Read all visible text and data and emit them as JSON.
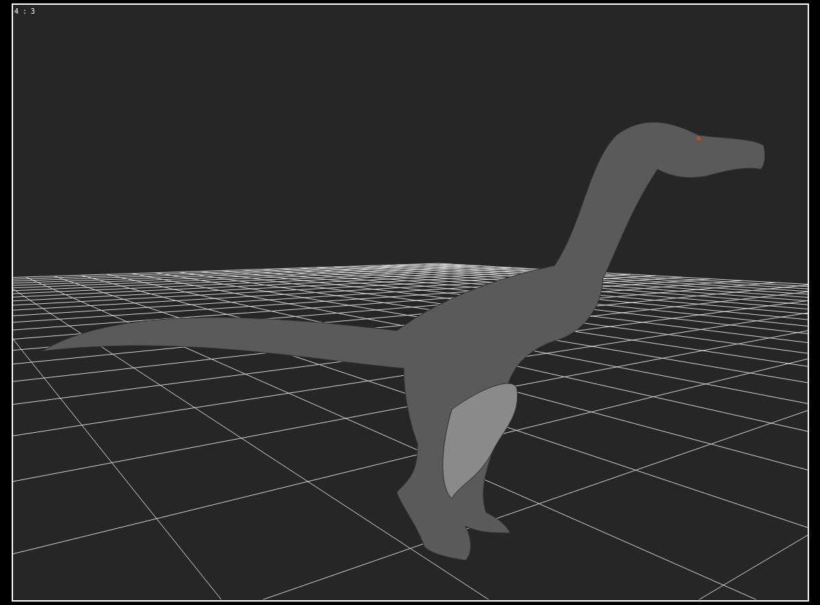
{
  "viewport": {
    "aspect_label": "4 : 3"
  }
}
